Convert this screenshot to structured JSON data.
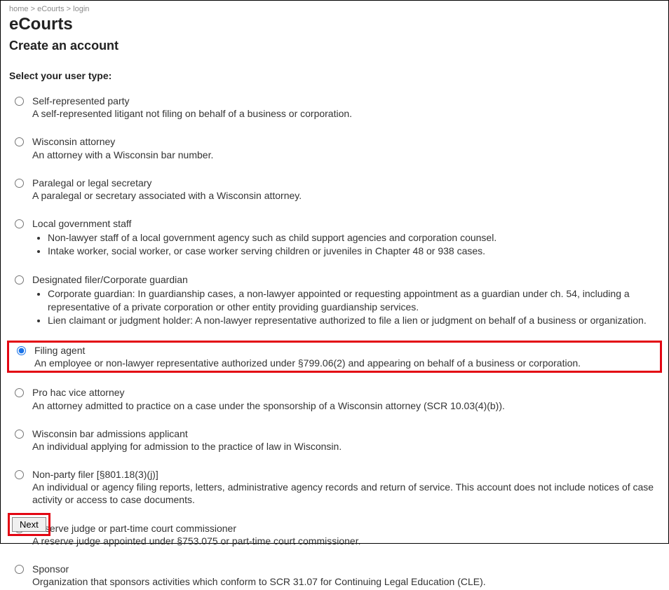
{
  "breadcrumb": {
    "items": [
      "home",
      "eCourts",
      "login"
    ],
    "sep": " > "
  },
  "title": "eCourts",
  "subtitle": "Create an account",
  "prompt": "Select your user type:",
  "options": [
    {
      "label": "Self-represented party",
      "desc": "A self-represented litigant not filing on behalf of a business or corporation.",
      "selected": false,
      "highlight": false
    },
    {
      "label": "Wisconsin attorney",
      "desc": "An attorney with a Wisconsin bar number.",
      "selected": false,
      "highlight": false
    },
    {
      "label": "Paralegal or legal secretary",
      "desc": "A paralegal or secretary associated with a Wisconsin attorney.",
      "selected": false,
      "highlight": false
    },
    {
      "label": "Local government staff",
      "bullets": [
        "Non-lawyer staff of a local government agency such as child support agencies and corporation counsel.",
        "Intake worker, social worker, or case worker serving children or juveniles in Chapter 48 or 938 cases."
      ],
      "selected": false,
      "highlight": false
    },
    {
      "label": "Designated filer/Corporate guardian",
      "bullets": [
        "Corporate guardian: In guardianship cases, a non-lawyer appointed or requesting appointment as a guardian under ch. 54, including a representative of a private corporation or other entity providing guardianship services.",
        "Lien claimant or judgment holder: A non-lawyer representative authorized to file a lien or judgment on behalf of a business or organization."
      ],
      "selected": false,
      "highlight": false
    },
    {
      "label": "Filing agent",
      "desc": "An employee or non-lawyer representative authorized under §799.06(2) and appearing on behalf of a business or corporation.",
      "selected": true,
      "highlight": true
    },
    {
      "label": "Pro hac vice attorney",
      "desc": "An attorney admitted to practice on a case under the sponsorship of a Wisconsin attorney (SCR 10.03(4)(b)).",
      "selected": false,
      "highlight": false
    },
    {
      "label": "Wisconsin bar admissions applicant",
      "desc": "An individual applying for admission to the practice of law in Wisconsin.",
      "selected": false,
      "highlight": false
    },
    {
      "label": "Non-party filer [§801.18(3)(j)]",
      "desc": "An individual or agency filing reports, letters, administrative agency records and return of service. This account does not include notices of case activity or access to case documents.",
      "selected": false,
      "highlight": false
    },
    {
      "label": "Reserve judge or part-time court commissioner",
      "desc": "A reserve judge appointed under §753.075 or part-time court commissioner.",
      "selected": false,
      "highlight": false
    },
    {
      "label": "Sponsor",
      "desc": "Organization that sponsors activities which conform to SCR 31.07 for Continuing Legal Education (CLE).",
      "selected": false,
      "highlight": false
    }
  ],
  "next_label": "Next"
}
